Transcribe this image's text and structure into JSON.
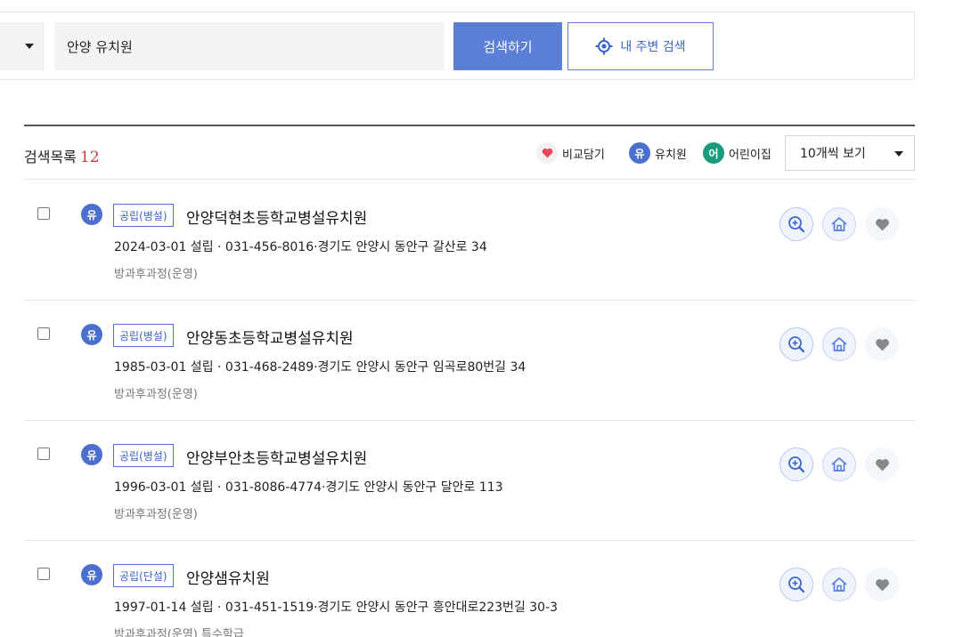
{
  "search": {
    "query": "안양 유치원",
    "search_button_label": "검색하기",
    "nearby_button_label": "내 주변 검색"
  },
  "list": {
    "title": "검색목록",
    "count": "12",
    "legend": {
      "compare_label": "비교담기",
      "kindergarten_badge": "유",
      "kindergarten_label": "유치원",
      "daycare_badge": "어",
      "daycare_label": "어린이집"
    },
    "per_page_label": "10개씩 보기"
  },
  "items": [
    {
      "type_badge": "유",
      "tag": "공립(병설)",
      "name": "안양덕현초등학교병설유치원",
      "info": "2024-03-01 설립 · 031-456-8016·경기도 안양시 동안구 갈산로 34",
      "extra": "방과후과정(운영)"
    },
    {
      "type_badge": "유",
      "tag": "공립(병설)",
      "name": "안양동초등학교병설유치원",
      "info": "1985-03-01 설립 · 031-468-2489·경기도 안양시 동안구 임곡로80번길 34",
      "extra": "방과후과정(운영)"
    },
    {
      "type_badge": "유",
      "tag": "공립(병설)",
      "name": "안양부안초등학교병설유치원",
      "info": "1996-03-01 설립 · 031-8086-4774·경기도 안양시 동안구 달안로 113",
      "extra": "방과후과정(운영)"
    },
    {
      "type_badge": "유",
      "tag": "공립(단설)",
      "name": "안양샘유치원",
      "info": "1997-01-14 설립 · 031-451-1519·경기도 안양시 동안구 흥안대로223번길 30-3",
      "extra": "방과후과정(운영) 특수학급"
    }
  ],
  "colors": {
    "primary": "#5b7fd6",
    "kindergarten_badge": "#4b6fcf",
    "daycare_badge": "#1c9a7e",
    "count": "#c83c3c",
    "heart": "#e8485a"
  },
  "icons": {
    "nearby": "target-icon",
    "region_dropdown": "chevron-down-icon",
    "zoom": "zoom-in-icon",
    "home": "home-icon",
    "like": "heart-icon"
  }
}
